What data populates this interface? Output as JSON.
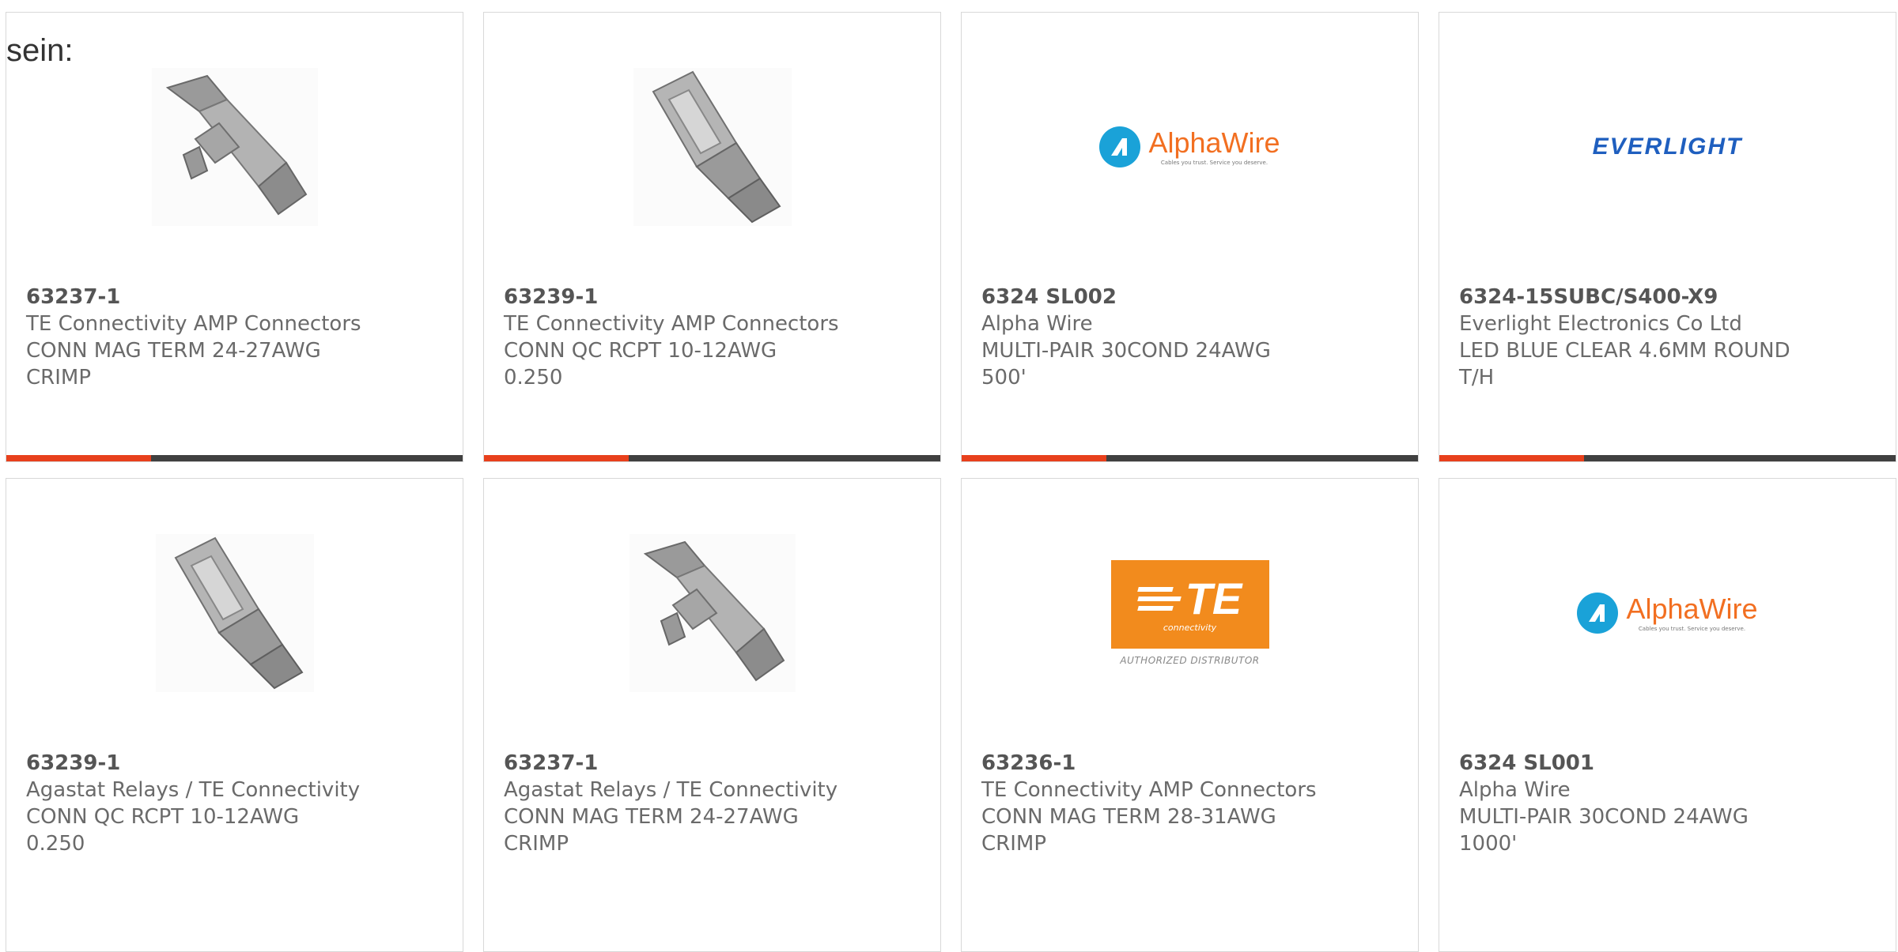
{
  "heading": "sein:",
  "colors": {
    "accent": "#e8401c",
    "bar": "#404040",
    "alphawire_blue": "#1aa2d8",
    "alphawire_orange": "#f26f21",
    "everlight_blue": "#1f5fbf",
    "te_orange": "#f28b1d"
  },
  "products": [
    {
      "part_number": "63237-1",
      "manufacturer": "TE Connectivity AMP Connectors",
      "description": "CONN MAG TERM 24-27AWG CRIMP",
      "image": "magnetic-terminal-photo"
    },
    {
      "part_number": "63239-1",
      "manufacturer": "TE Connectivity AMP Connectors",
      "description": "CONN QC RCPT 10-12AWG 0.250",
      "image": "quick-connect-receptacle-photo"
    },
    {
      "part_number": "6324 SL002",
      "manufacturer": "Alpha Wire",
      "description": "MULTI-PAIR 30COND 24AWG 500'",
      "image": "alphawire-logo"
    },
    {
      "part_number": "6324-15SUBC/S400-X9",
      "manufacturer": "Everlight Electronics Co Ltd",
      "description": "LED BLUE CLEAR 4.6MM ROUND T/H",
      "image": "everlight-logo"
    },
    {
      "part_number": "63239-1",
      "manufacturer": "Agastat Relays / TE Connectivity",
      "description": "CONN QC RCPT 10-12AWG 0.250",
      "image": "quick-connect-receptacle-photo"
    },
    {
      "part_number": "63237-1",
      "manufacturer": "Agastat Relays / TE Connectivity",
      "description": "CONN MAG TERM 24-27AWG CRIMP",
      "image": "magnetic-terminal-photo"
    },
    {
      "part_number": "63236-1",
      "manufacturer": "TE Connectivity AMP Connectors",
      "description": "CONN MAG TERM 28-31AWG CRIMP",
      "image": "te-connectivity-logo"
    },
    {
      "part_number": "6324 SL001",
      "manufacturer": "Alpha Wire",
      "description": "MULTI-PAIR 30COND 24AWG 1000'",
      "image": "alphawire-logo"
    }
  ],
  "logos": {
    "alphawire": {
      "name": "AlphaWire",
      "tagline": "Cables you trust. Service you deserve."
    },
    "everlight": {
      "name": "EVERLIGHT"
    },
    "te": {
      "letters": "TE",
      "sub": "connectivity",
      "authorized": "AUTHORIZED DISTRIBUTOR"
    }
  }
}
